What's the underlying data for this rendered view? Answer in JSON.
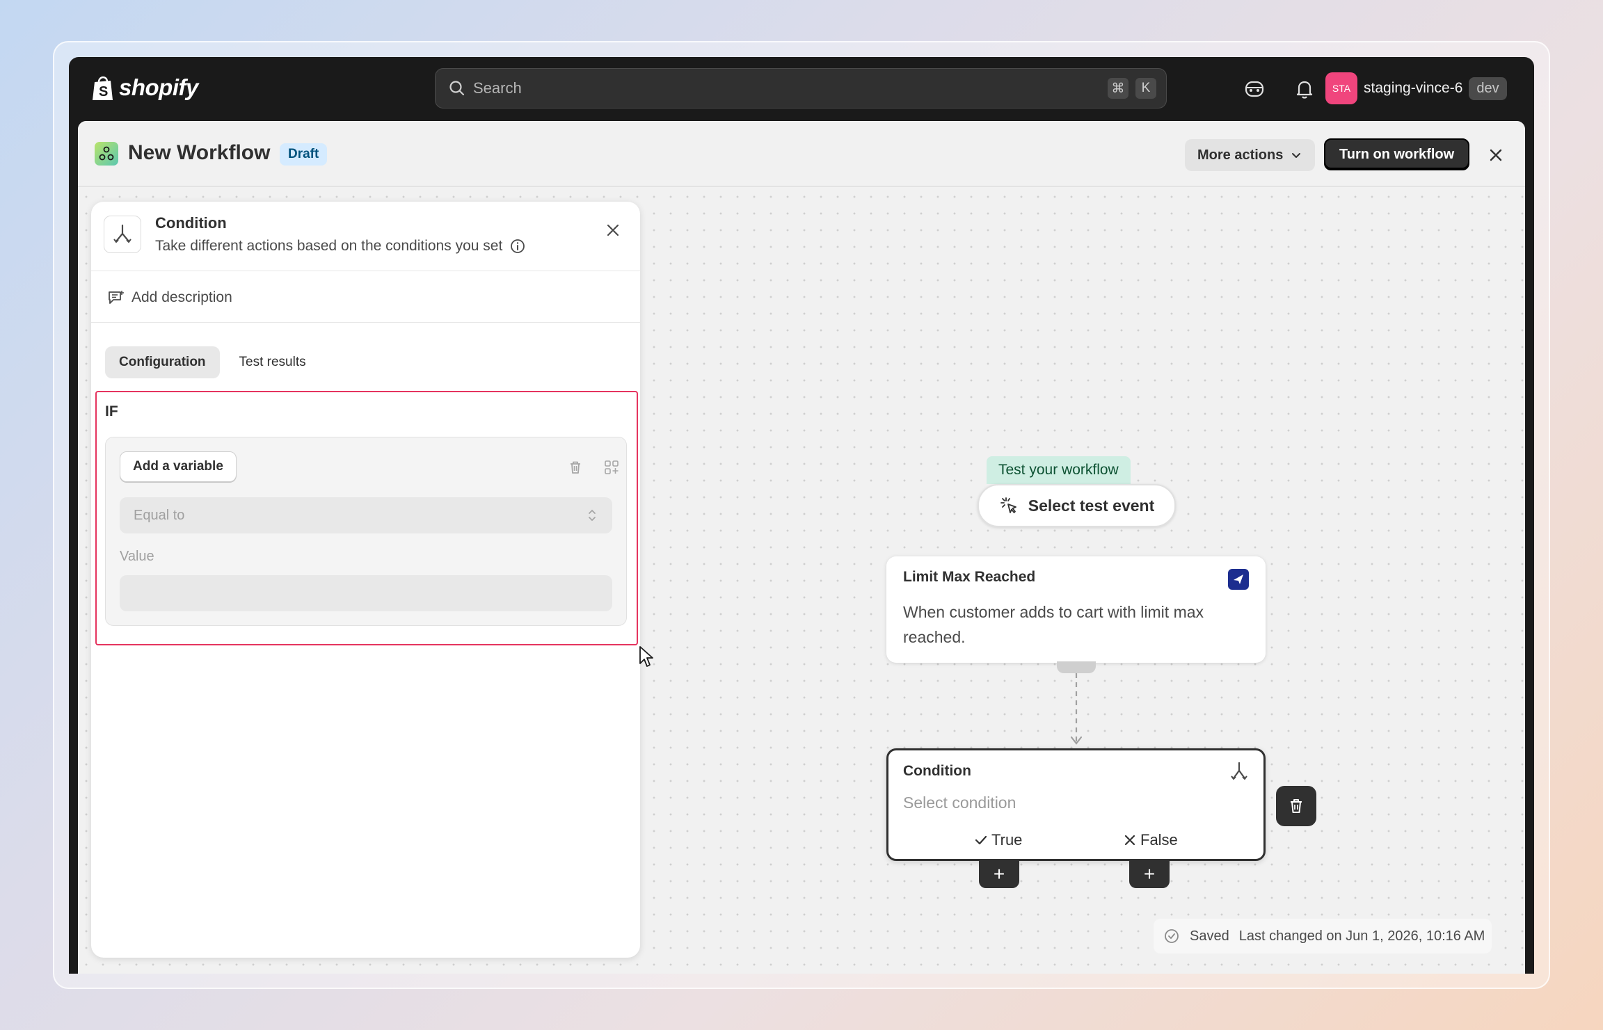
{
  "topbar": {
    "logo_text": "shopify",
    "search_placeholder": "Search",
    "shortcut_keys": [
      "⌘",
      "K"
    ],
    "account": {
      "avatar_initials": "STA",
      "name": "staging-vince-6",
      "badge": "dev"
    }
  },
  "header": {
    "title": "New Workflow",
    "status_badge": "Draft",
    "more_actions_label": "More actions",
    "turn_on_label": "Turn on workflow"
  },
  "panel": {
    "title": "Condition",
    "subtitle": "Take different actions based on the conditions you set",
    "add_description": "Add description",
    "tabs": [
      {
        "label": "Configuration",
        "active": true
      },
      {
        "label": "Test results",
        "active": false
      }
    ],
    "if_label": "IF",
    "add_variable_label": "Add a variable",
    "operator_placeholder": "Equal to",
    "value_label": "Value"
  },
  "canvas": {
    "test_tag": "Test your workflow",
    "select_test_event": "Select test event",
    "trigger": {
      "title": "Limit Max Reached",
      "description": "When customer adds to cart with limit max reached."
    },
    "condition_node": {
      "title": "Condition",
      "placeholder": "Select condition",
      "true_label": "True",
      "false_label": "False"
    },
    "saved": {
      "status": "Saved",
      "last_changed": "Last changed on Jun 1, 2026, 10:16 AM"
    }
  },
  "colors": {
    "topbar_bg": "#1a1a1a",
    "avatar_bg": "#f0457d",
    "draft_badge_bg": "#d5ebff",
    "test_tag_bg": "#cfeee3",
    "highlight_border": "#e5345f"
  }
}
